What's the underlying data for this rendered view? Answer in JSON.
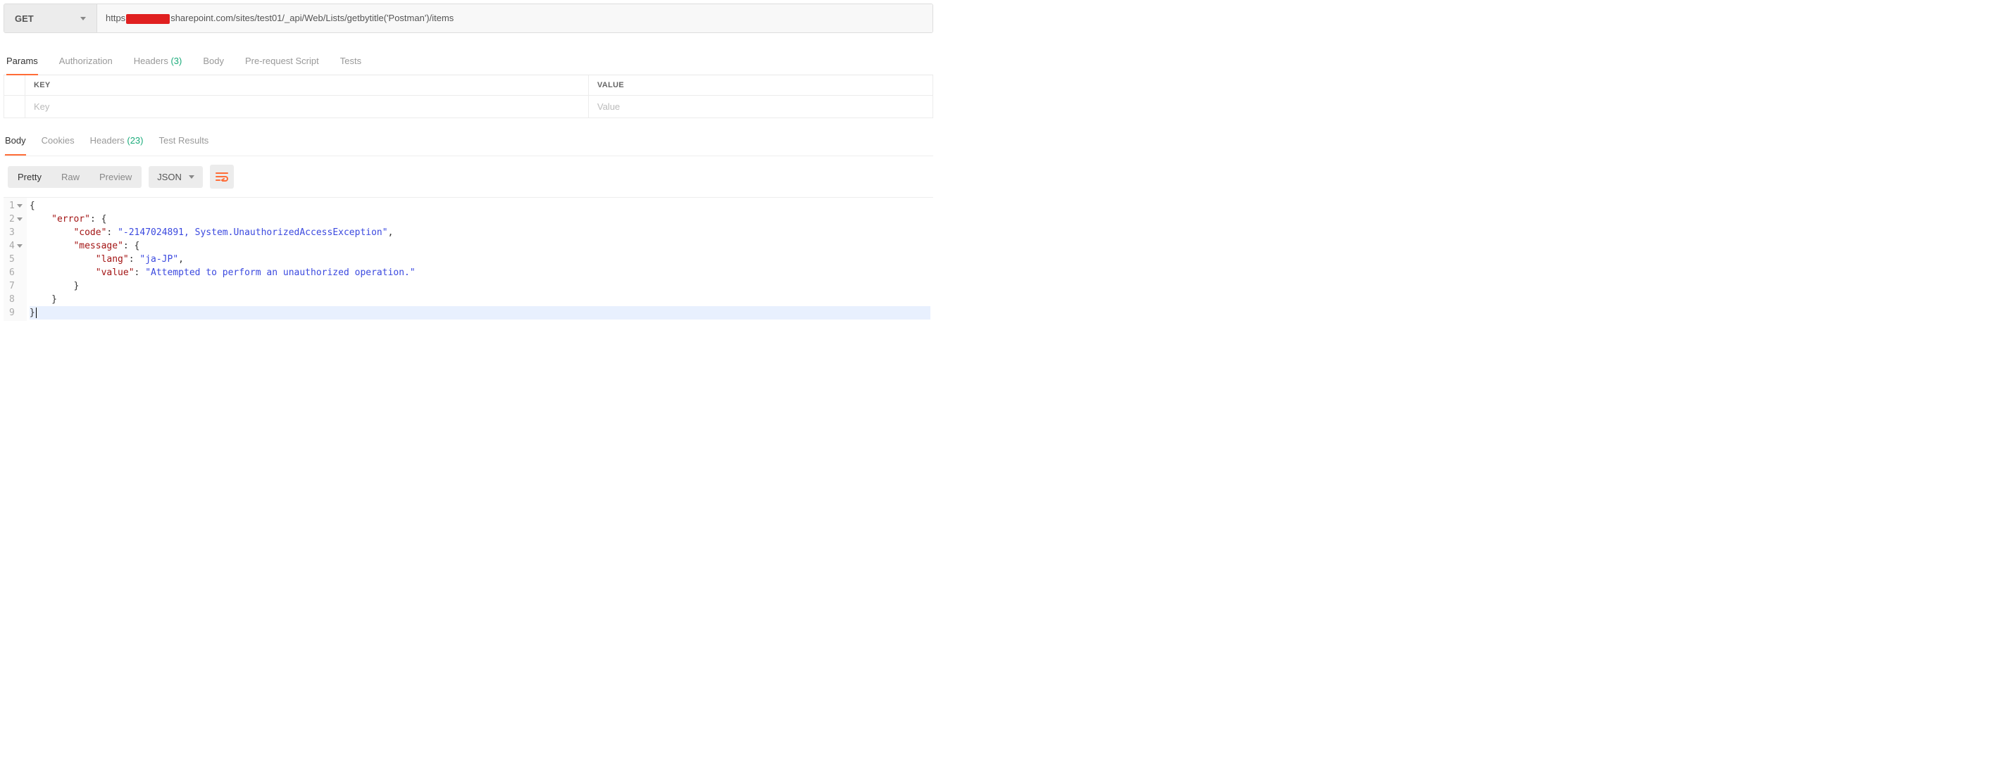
{
  "request": {
    "method": "GET",
    "url_prefix": "https",
    "url_suffix": "sharepoint.com/sites/test01/_api/Web/Lists/getbytitle('Postman')/items"
  },
  "request_tabs": {
    "params": "Params",
    "authorization": "Authorization",
    "headers_label": "Headers",
    "headers_count": "(3)",
    "body": "Body",
    "prerequest": "Pre-request Script",
    "tests": "Tests"
  },
  "params_table": {
    "header_key": "KEY",
    "header_value": "VALUE",
    "placeholder_key": "Key",
    "placeholder_value": "Value"
  },
  "response_tabs": {
    "body": "Body",
    "cookies": "Cookies",
    "headers_label": "Headers",
    "headers_count": "(23)",
    "test_results": "Test Results"
  },
  "toolbar": {
    "pretty": "Pretty",
    "raw": "Raw",
    "preview": "Preview",
    "format": "JSON"
  },
  "response_body": {
    "lines": [
      {
        "n": "1",
        "fold": true,
        "indent": 0,
        "tokens": [
          {
            "t": "punct",
            "v": "{"
          }
        ]
      },
      {
        "n": "2",
        "fold": true,
        "indent": 1,
        "tokens": [
          {
            "t": "key",
            "v": "\"error\""
          },
          {
            "t": "punct",
            "v": ": {"
          }
        ]
      },
      {
        "n": "3",
        "fold": false,
        "indent": 2,
        "tokens": [
          {
            "t": "key",
            "v": "\"code\""
          },
          {
            "t": "punct",
            "v": ": "
          },
          {
            "t": "str",
            "v": "\"-2147024891, System.UnauthorizedAccessException\""
          },
          {
            "t": "punct",
            "v": ","
          }
        ]
      },
      {
        "n": "4",
        "fold": true,
        "indent": 2,
        "tokens": [
          {
            "t": "key",
            "v": "\"message\""
          },
          {
            "t": "punct",
            "v": ": {"
          }
        ]
      },
      {
        "n": "5",
        "fold": false,
        "indent": 3,
        "tokens": [
          {
            "t": "key",
            "v": "\"lang\""
          },
          {
            "t": "punct",
            "v": ": "
          },
          {
            "t": "str",
            "v": "\"ja-JP\""
          },
          {
            "t": "punct",
            "v": ","
          }
        ]
      },
      {
        "n": "6",
        "fold": false,
        "indent": 3,
        "tokens": [
          {
            "t": "key",
            "v": "\"value\""
          },
          {
            "t": "punct",
            "v": ": "
          },
          {
            "t": "str",
            "v": "\"Attempted to perform an unauthorized operation.\""
          }
        ]
      },
      {
        "n": "7",
        "fold": false,
        "indent": 2,
        "tokens": [
          {
            "t": "punct",
            "v": "}"
          }
        ]
      },
      {
        "n": "8",
        "fold": false,
        "indent": 1,
        "tokens": [
          {
            "t": "punct",
            "v": "}"
          }
        ]
      },
      {
        "n": "9",
        "fold": false,
        "indent": 0,
        "hl": true,
        "tokens": [
          {
            "t": "punct",
            "v": "}"
          }
        ],
        "cursor": true
      }
    ]
  }
}
